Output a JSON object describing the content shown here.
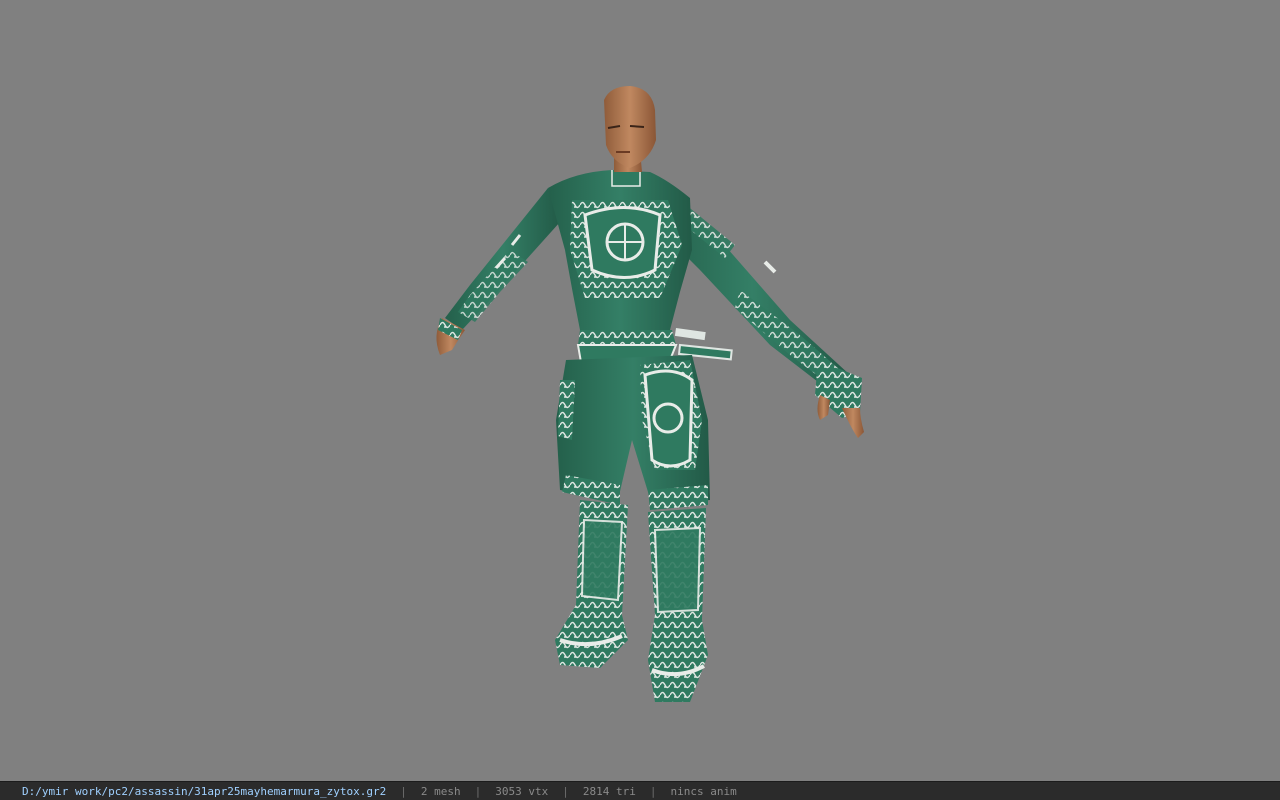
{
  "viewer": {
    "background_color": "#808080",
    "model": {
      "description_icon": "character-model",
      "primary_color": "#2f7a60",
      "trim_color": "#e8ece8",
      "skin_color": "#b07a52"
    }
  },
  "statusbar": {
    "file_path": "D:/ymir work/pc2/assassin/31apr25mayhemarmura_zytox.gr2",
    "separator": "|",
    "mesh_count": "2 mesh",
    "vertex_count": "3053 vtx",
    "triangle_count": "2814 tri",
    "anim_status": "nincs anim"
  }
}
